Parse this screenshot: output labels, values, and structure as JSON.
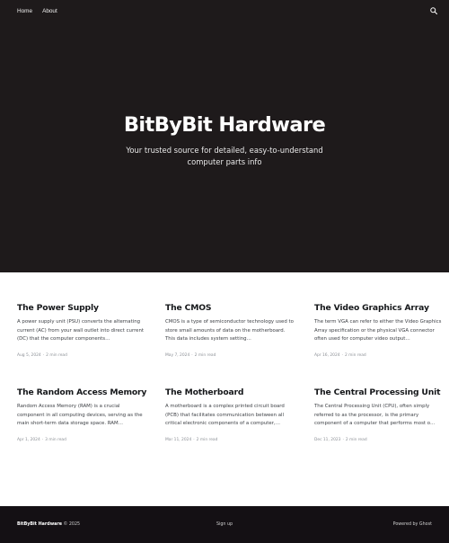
{
  "nav": {
    "links": [
      {
        "label": "Home"
      },
      {
        "label": "About"
      }
    ],
    "search_icon": "search-icon"
  },
  "hero": {
    "title": "BitByBit Hardware",
    "description": "Your trusted source for detailed, easy-to-understand computer parts info"
  },
  "posts": [
    {
      "title": "The Power Supply",
      "excerpt": "A power supply unit (PSU) converts the alternating current (AC) from your wall outlet into direct current (DC) that the computer components…",
      "date": "Aug 5, 2024",
      "read_time": "2 min read"
    },
    {
      "title": "The CMOS",
      "excerpt": "CMOS is a type of semiconductor technology used to store small amounts of data on the motherboard. This data includes system setting…",
      "date": "May 7, 2024",
      "read_time": "2 min read"
    },
    {
      "title": "The Video Graphics Array",
      "excerpt": "The term VGA can refer to either the Video Graphics Array specification or the physical VGA connector often used for computer video output…",
      "date": "Apr 16, 2024",
      "read_time": "2 min read"
    },
    {
      "title": "The Random Access Memory",
      "excerpt": "Random Access Memory (RAM) is a crucial component in all computing devices, serving as the main short-term data storage space. RAM…",
      "date": "Apr 1, 2024",
      "read_time": "3 min read"
    },
    {
      "title": "The Motherboard",
      "excerpt": "A motherboard is a complex printed circuit board (PCB) that facilitates communication between all critical electronic components of a computer,…",
      "date": "Mar 11, 2024",
      "read_time": "2 min read"
    },
    {
      "title": "The Central Processing Unit",
      "excerpt": "The Central Processing Unit (CPU), often simply referred to as the processor, is the primary component of a computer that performs most o…",
      "date": "Dec 11, 2023",
      "read_time": "2 min read"
    }
  ],
  "meta_separator": "·",
  "footer": {
    "brand": "BitByBit Hardware",
    "copyright": "© 2025",
    "signup": "Sign up",
    "powered": "Powered by Ghost"
  },
  "colors": {
    "hero_bg": "#1e1a1b",
    "footer_bg": "#141014",
    "text": "#15171a"
  }
}
